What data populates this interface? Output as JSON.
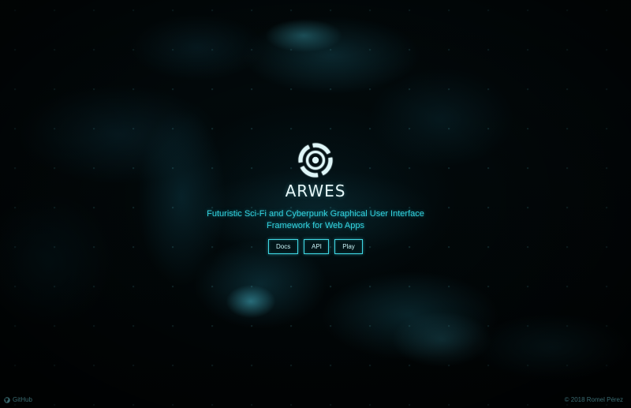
{
  "brand": {
    "title": "ARWES",
    "tagline": "Futuristic Sci-Fi and Cyberpunk Graphical User Interface Framework for Web Apps",
    "logo_icon": "arwes-logo-icon"
  },
  "nav": {
    "docs_label": "Docs",
    "api_label": "API",
    "play_label": "Play"
  },
  "footer": {
    "github_label": "GitHub",
    "github_icon": "github-icon",
    "copyright": "© 2018 Romel Pérez"
  },
  "colors": {
    "accent": "#33d4e0",
    "title": "#e6f7f8",
    "background": "#010607",
    "button_border": "#3fd8e4",
    "footer_text": "#3a6c72"
  }
}
